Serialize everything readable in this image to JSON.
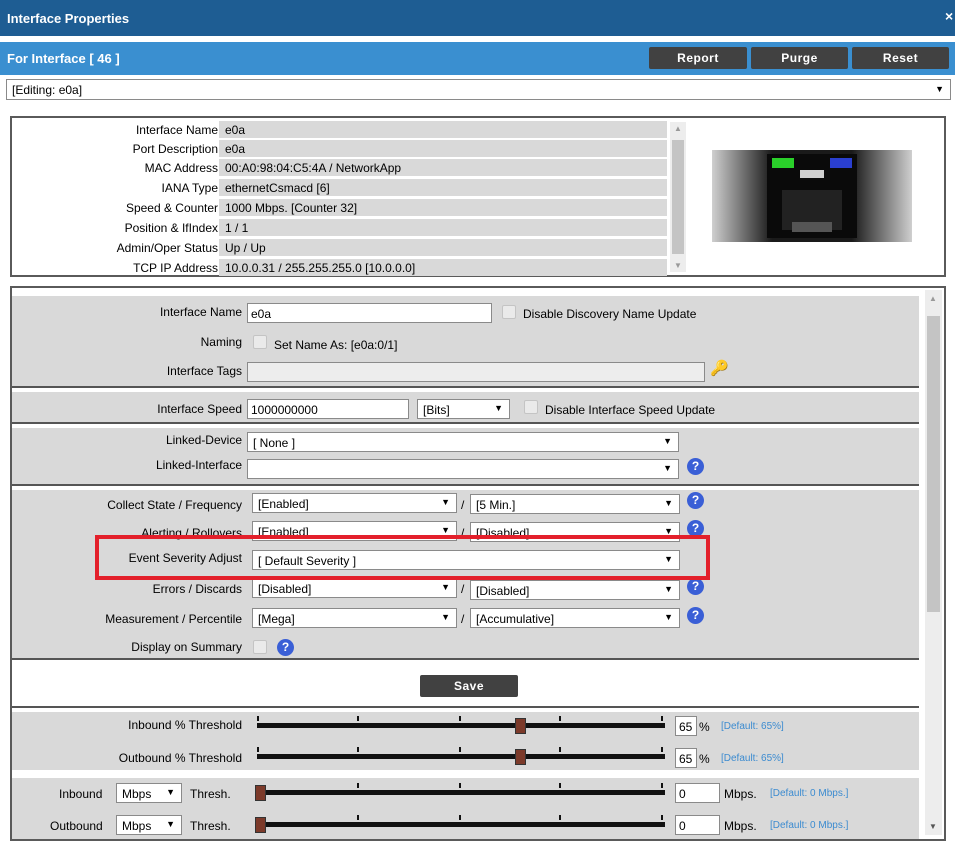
{
  "window": {
    "title": "Interface Properties",
    "close": "×"
  },
  "header": {
    "title": "For Interface [ 46 ]",
    "report_label": "Report",
    "purge_label": "Purge",
    "reset_label": "Reset",
    "editing_select": "[Editing: e0a]"
  },
  "info": {
    "rows": [
      {
        "label": "Interface Name",
        "value": "e0a"
      },
      {
        "label": "Port Description",
        "value": "e0a"
      },
      {
        "label": "MAC Address",
        "value": "00:A0:98:04:C5:4A / NetworkApp"
      },
      {
        "label": "IANA Type",
        "value": "ethernetCsmacd [6]"
      },
      {
        "label": "Speed & Counter",
        "value": "1000 Mbps. [Counter 32]"
      },
      {
        "label": "Position & IfIndex",
        "value": "1 / 1"
      },
      {
        "label": "Admin/Oper Status",
        "value": "Up / Up"
      },
      {
        "label": "TCP IP Address",
        "value": "10.0.0.31 / 255.255.255.0 [10.0.0.0]"
      }
    ]
  },
  "form": {
    "interface_name": {
      "label": "Interface Name",
      "value": "e0a",
      "checkbox_label": "Disable Discovery Name Update"
    },
    "naming": {
      "label": "Naming",
      "checkbox_label": "Set Name As: [e0a:0/1]"
    },
    "interface_tags": {
      "label": "Interface Tags",
      "value": ""
    },
    "interface_speed": {
      "label": "Interface Speed",
      "value": "1000000000",
      "unit": "[Bits]",
      "checkbox_label": "Disable Interface Speed Update"
    },
    "linked_device": {
      "label": "Linked-Device",
      "value": "[ None ]"
    },
    "linked_interface": {
      "label": "Linked-Interface",
      "value": ""
    },
    "collect_state": {
      "label": "Collect State / Frequency",
      "value1": "[Enabled]",
      "value2": "[5 Min.]"
    },
    "alerting": {
      "label": "Alerting / Rollovers",
      "value1": "[Enabled]",
      "value2": "[Disabled]"
    },
    "event_severity": {
      "label": "Event Severity Adjust",
      "value": "[ Default Severity ]"
    },
    "errors": {
      "label": "Errors / Discards",
      "value1": "[Disabled]",
      "value2": "[Disabled]"
    },
    "measurement": {
      "label": "Measurement / Percentile",
      "value1": "[Mega]",
      "value2": "[Accumulative]"
    },
    "display_summary": {
      "label": "Display on Summary"
    },
    "save_label": "Save",
    "slash": "/",
    "help": "?"
  },
  "thresholds": {
    "inbound_pct": {
      "label": "Inbound % Threshold",
      "value": "65",
      "unit": "%",
      "default": "[Default: 65%]",
      "level": 0.65
    },
    "outbound_pct": {
      "label": "Outbound % Threshold",
      "value": "65",
      "unit": "%",
      "default": "[Default: 65%]",
      "level": 0.65
    },
    "inbound_mbps": {
      "label": "Inbound",
      "unit_select": "Mbps",
      "thresh": "Thresh.",
      "value": "0",
      "unit": "Mbps.",
      "default": "[Default: 0 Mbps.]",
      "level": 0
    },
    "outbound_mbps": {
      "label": "Outbound",
      "unit_select": "Mbps",
      "thresh": "Thresh.",
      "value": "0",
      "unit": "Mbps.",
      "default": "[Default: 0 Mbps.]",
      "level": 0
    }
  },
  "colors": {
    "titlebar": "#1e5d93",
    "subbar": "#3a8fd0",
    "highlight": "#e3202b",
    "help": "#3a5fd6"
  }
}
